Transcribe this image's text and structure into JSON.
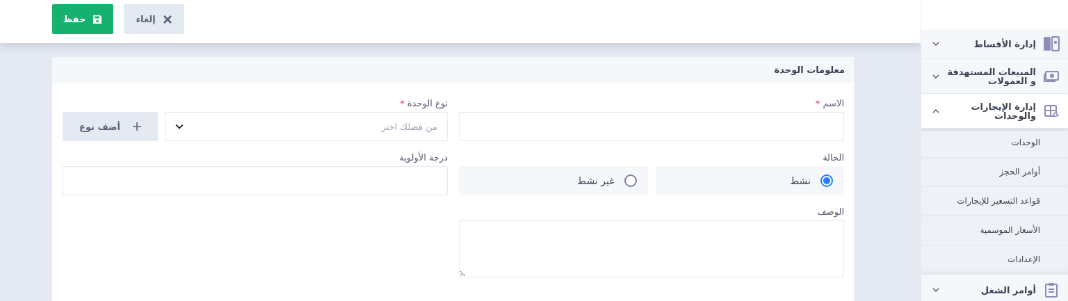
{
  "toolbar": {
    "buttons": [
      {
        "kind": "cancel",
        "label": "إلغاء"
      },
      {
        "kind": "save",
        "label": "حفظ"
      }
    ]
  },
  "card": {
    "title": "معلومات الوحدة",
    "fields": [
      {
        "kind": "text",
        "label": "الاسم",
        "required_mark": "*"
      },
      {
        "kind": "select",
        "label": "نوع الوحدة",
        "required_mark": "*",
        "placeholder": "من فضلك اختر",
        "add_button": "أضف نوع"
      },
      {
        "kind": "radio",
        "label": "الحالة",
        "options": [
          {
            "label": "نشط",
            "selected": true
          },
          {
            "label": "غير نشط",
            "selected": false
          }
        ]
      },
      {
        "kind": "text",
        "label": "درجة الأولوية"
      },
      {
        "kind": "textarea",
        "label": "الوصف"
      }
    ]
  },
  "sidebar": {
    "items": [
      {
        "label": "إدارة الأقساط",
        "expanded": false
      },
      {
        "label": "المبيعات المستهدفة و العمولات",
        "expanded": false
      },
      {
        "label": "إدارة الإيجارات والوحدات",
        "expanded": true,
        "children": [
          {
            "label": "الوحدات"
          },
          {
            "label": "أوامر الحجز"
          },
          {
            "label": "قواعد التسعير للإيجارات"
          },
          {
            "label": "الأسعار الموسمية"
          },
          {
            "label": "الإعدادات"
          }
        ]
      },
      {
        "label": "أوامر الشغل",
        "expanded": false
      }
    ]
  }
}
